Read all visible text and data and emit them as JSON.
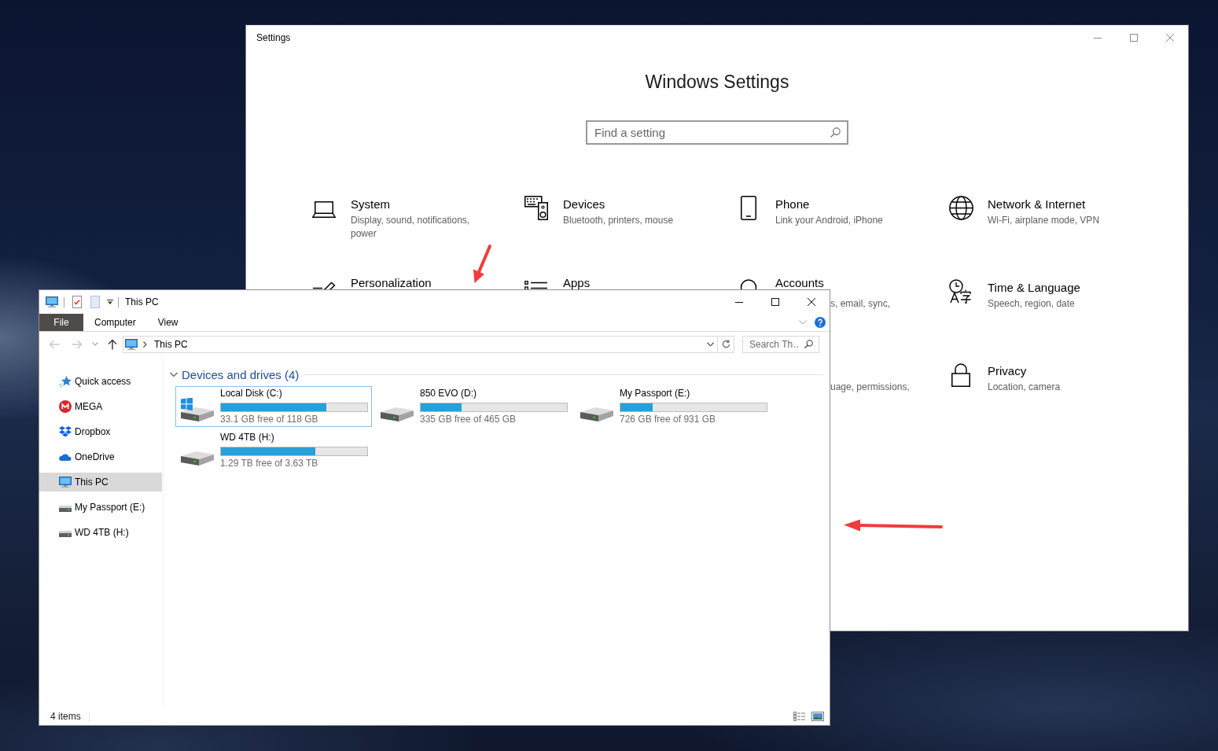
{
  "settings_window": {
    "title": "Settings",
    "heading": "Windows Settings",
    "search": {
      "placeholder": "Find a setting"
    },
    "category_rows": [
      {
        "tiles": [
          {
            "title": "System",
            "description": "Display, sound, notifications, power"
          },
          {
            "title": "Devices",
            "description": "Bluetooth, printers, mouse"
          },
          {
            "title": "Phone",
            "description": "Link your Android, iPhone"
          },
          {
            "title": "Network & Internet",
            "description": "Wi-Fi, airplane mode, VPN"
          }
        ]
      },
      {
        "tiles": [
          {
            "title": "Personalization"
          },
          {
            "title": "Apps"
          },
          {
            "title": "Accounts",
            "description": "s, email, sync,"
          },
          {
            "title": "Time & Language",
            "description": "Speech, region, date"
          }
        ]
      },
      {
        "tiles": [
          {
            "description": "uage, permissions,"
          },
          {
            "title": "Privacy",
            "description": "Location, camera"
          }
        ]
      }
    ]
  },
  "explorer_window": {
    "title": "This PC",
    "ribbon_tabs": [
      {
        "label": "File",
        "kind": "menu"
      },
      {
        "label": "Computer",
        "kind": "tab"
      },
      {
        "label": "View",
        "kind": "tab"
      }
    ],
    "navigation": {
      "back_enabled": false,
      "forward_enabled": false
    },
    "address": {
      "location": "This PC"
    },
    "search": {
      "placeholder": "Search Th…"
    },
    "nav_items": [
      {
        "label": "Quick access",
        "selected": false
      },
      {
        "label": "MEGA",
        "selected": false
      },
      {
        "label": "Dropbox",
        "selected": false
      },
      {
        "label": "OneDrive",
        "selected": false
      },
      {
        "label": "This PC",
        "selected": true
      },
      {
        "label": "My Passport (E:)",
        "selected": false
      },
      {
        "label": "WD 4TB (H:)",
        "selected": false
      }
    ],
    "drive_group": {
      "header": "Devices and drives (4)",
      "expanded": true,
      "drives": [
        {
          "name": "Local Disk (C:)",
          "kind": "system",
          "level": 0.72,
          "free_space": "33.1 GB free of 118 GB",
          "focused": true
        },
        {
          "name": "850 EVO (D:)",
          "kind": "disk",
          "level": 0.28,
          "free_space": "335 GB free of 465 GB",
          "focused": false
        },
        {
          "name": "My Passport (E:)",
          "kind": "disk",
          "level": 0.22,
          "free_space": "726 GB free of 931 GB",
          "focused": false
        },
        {
          "name": "WD 4TB (H:)",
          "kind": "disk",
          "level": 0.645,
          "free_space": "1.29 TB free of 3.63 TB",
          "focused": false
        }
      ]
    },
    "status_bar": {
      "item_count": "4 items"
    }
  }
}
